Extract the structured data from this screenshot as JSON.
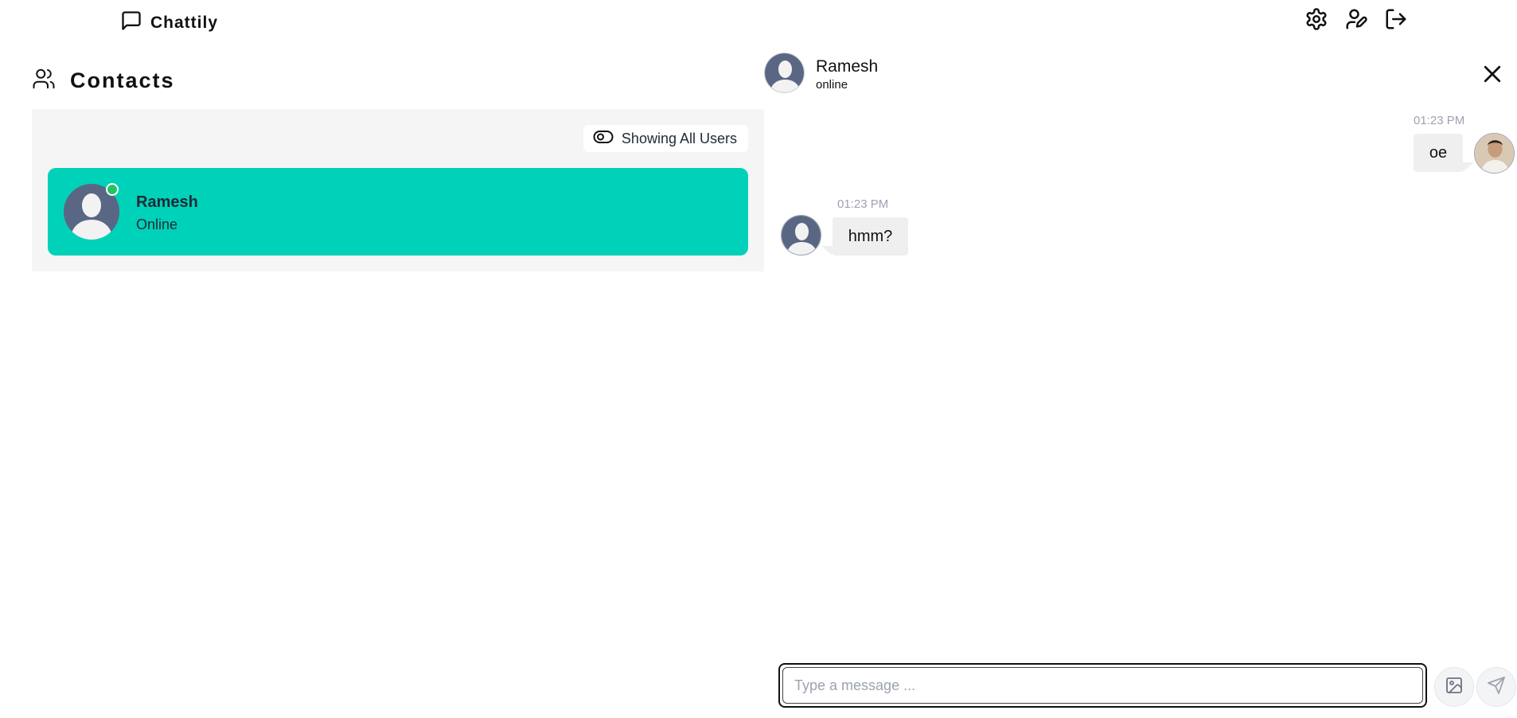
{
  "app": {
    "name": "Chattily"
  },
  "nav": {
    "icons": [
      "message-square-icon",
      "settings-icon",
      "user-edit-icon",
      "logout-icon"
    ]
  },
  "contacts": {
    "title": "Contacts",
    "filter_label": "Showing All Users",
    "items": [
      {
        "name": "Ramesh",
        "status": "Online",
        "online": true
      }
    ]
  },
  "chat": {
    "contact_name": "Ramesh",
    "contact_status": "online",
    "messages": [
      {
        "from": "me",
        "time": "01:23 PM",
        "text": "oe"
      },
      {
        "from": "them",
        "time": "01:23 PM",
        "text": "hmm?"
      }
    ],
    "composer": {
      "placeholder": "Type a message ..."
    }
  },
  "colors": {
    "accent": "#00d1b9",
    "online": "#22c55e",
    "panel_bg": "#f5f5f5",
    "bubble_bg": "#efefef",
    "avatar_bg": "#5a6784"
  }
}
